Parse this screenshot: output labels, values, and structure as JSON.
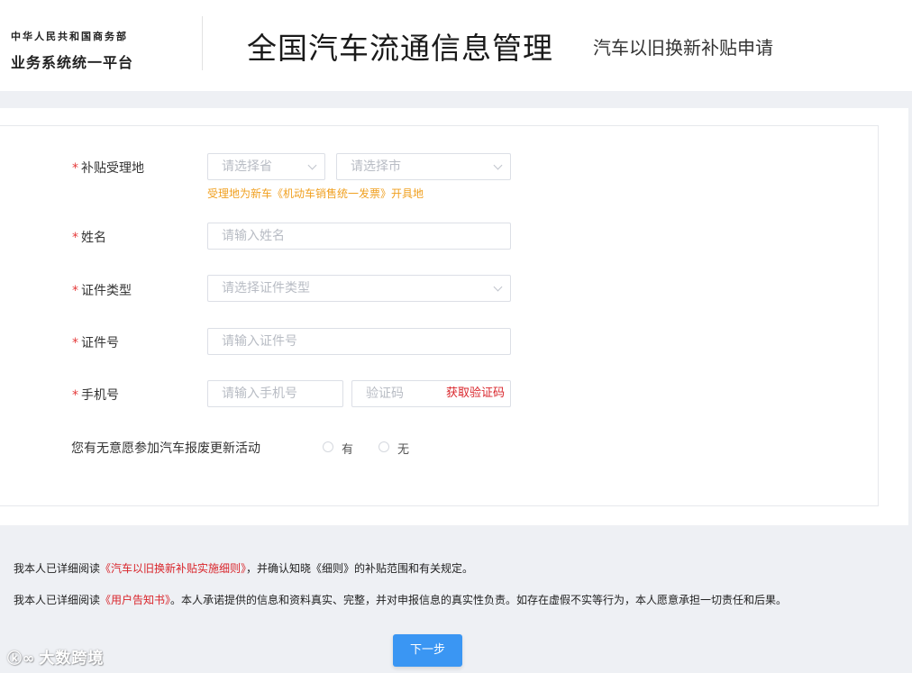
{
  "header": {
    "org_small": "中华人民共和国商务部",
    "org_large": "业务系统统一平台",
    "title": "全国汽车流通信息管理",
    "subtitle": "汽车以旧换新补贴申请"
  },
  "form": {
    "required_mark": "*",
    "location": {
      "label": "补贴受理地",
      "province_placeholder": "请选择省",
      "city_placeholder": "请选择市",
      "hint": "受理地为新车《机动车销售统一发票》开具地"
    },
    "name": {
      "label": "姓名",
      "placeholder": "请输入姓名"
    },
    "id_type": {
      "label": "证件类型",
      "placeholder": "请选择证件类型"
    },
    "id_number": {
      "label": "证件号",
      "placeholder": "请输入证件号"
    },
    "phone": {
      "label": "手机号",
      "placeholder": "请输入手机号",
      "code_placeholder": "验证码",
      "get_code_label": "获取验证码"
    },
    "scrap": {
      "question": "您有无意愿参加汽车报废更新活动",
      "options": [
        "有",
        "无"
      ]
    }
  },
  "agreements": {
    "line1": {
      "prefix": "我本人已详细阅读",
      "link": "《汽车以旧换新补贴实施细则》",
      "suffix": "，并确认知晓《细则》的补贴范围和有关规定。"
    },
    "line2": {
      "prefix": "我本人已详细阅读",
      "link": "《用户告知书》",
      "suffix": "。本人承诺提供的信息和资料真实、完整，并对申报信息的真实性负责。如存在虚假不实等行为，本人愿意承担一切责任和后果。"
    }
  },
  "next_button": "下一步",
  "watermark": {
    "logo": "ⓚ∞",
    "text": "大数跨境"
  }
}
